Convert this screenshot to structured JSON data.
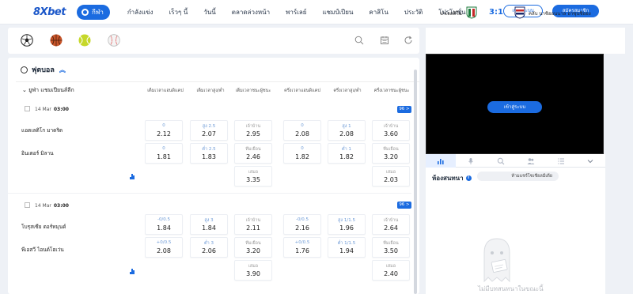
{
  "brand": {
    "logo": "8Xbet",
    "accent": "#1b6be0"
  },
  "nav": {
    "items": [
      "กีฬา",
      "กำลังแข่ง",
      "เร็วๆ นี้",
      "วันนี้",
      "ตลาดล่วงหน้า",
      "พาร์เลย์",
      "แชมป์เปียน",
      "คาสิโน",
      "ประวัติ",
      "โปรโมชั่น"
    ],
    "login": "เข้าสู่ระบบ",
    "register": "สมัครสมาชิก"
  },
  "sports": [
    "soccer-icon",
    "basketball-icon",
    "tennis-icon",
    "baseball-icon"
  ],
  "section": {
    "title": "ฟุตบอล",
    "league": "ยูฟ่า แชมเปียนส์ลีก",
    "columns": [
      "เต็มเวลาแฮนดิแคป",
      "เต็มเวลาสูง/ต่ำ",
      "เต็มเวลาชนะผู้ชนะ",
      "ครึ่งเวลาแฮนดิแคป",
      "ครึ่งเวลาสูง/ต่ำ",
      "ครึ่งเวลาชนะผู้ชนะ"
    ]
  },
  "matches": [
    {
      "date": "14 Mar",
      "time": "03:00",
      "more": "96 >",
      "home": "แอตเลติโก มาดริด",
      "away": "อินเตอร์ มิลาน",
      "odds_home": [
        [
          "0",
          "2.12"
        ],
        [
          "สูง 2.5",
          "2.07"
        ],
        [
          "เจ้าบ้าน",
          "2.95"
        ],
        [
          "0",
          "2.08"
        ],
        [
          "สูง 1",
          "2.08"
        ],
        [
          "เจ้าบ้าน",
          "3.60"
        ]
      ],
      "odds_away": [
        [
          "0",
          "1.81"
        ],
        [
          "ต่ำ 2.5",
          "1.83"
        ],
        [
          "ทีมเยือน",
          "2.46"
        ],
        [
          "0",
          "1.82"
        ],
        [
          "ต่ำ 1",
          "1.82"
        ],
        [
          "ทีมเยือน",
          "3.20"
        ]
      ],
      "draw_ft": [
        "เสมอ",
        "3.35"
      ],
      "draw_ht": [
        "เสมอ",
        "2.03"
      ]
    },
    {
      "date": "14 Mar",
      "time": "03:00",
      "more": "96 >",
      "home": "โบรุสเซีย ดอร์ทมุนด์",
      "away": "พีเอสวี ไอนด์โฮเว่น",
      "odds_home": [
        [
          "-0/0.5",
          "1.84"
        ],
        [
          "สูง 3",
          "1.84"
        ],
        [
          "เจ้าบ้าน",
          "2.11"
        ],
        [
          "-0/0.5",
          "2.16"
        ],
        [
          "สูง 1/1.5",
          "1.96"
        ],
        [
          "เจ้าบ้าน",
          "2.64"
        ]
      ],
      "odds_away": [
        [
          "+0/0.5",
          "2.08"
        ],
        [
          "ต่ำ 3",
          "2.06"
        ],
        [
          "ทีมเยือน",
          "3.20"
        ],
        [
          "+0/0.5",
          "1.76"
        ],
        [
          "ต่ำ 1/1.5",
          "1.94"
        ],
        [
          "ทีมเยือน",
          "3.50"
        ]
      ],
      "draw_ft": [
        "เสมอ",
        "3.90"
      ],
      "draw_ht": [
        "เสมอ",
        "2.40"
      ]
    }
  ],
  "live": {
    "home": "ปาเลสติโน",
    "score": "3:1",
    "away": "คลับ นาซิออนนาล อาซุนซิออง",
    "video_button": "เข้าสู่ระบบ"
  },
  "chat": {
    "title": "ห้องสนทนา",
    "info": "i",
    "input_placeholder": "ห้ามแชร์โซเชียลมีเดีย",
    "empty": "ไม่มีบทสนทนาในขณะนี้"
  }
}
